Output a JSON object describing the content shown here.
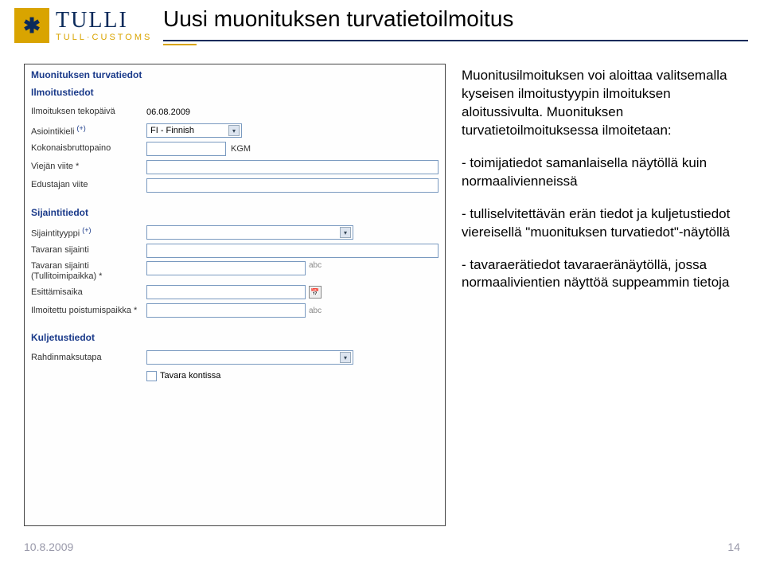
{
  "logo": {
    "main": "TULLI",
    "sub": "TULL·CUSTOMS",
    "mark": "✱"
  },
  "title": "Uusi muonituksen turvatietoilmoitus",
  "form": {
    "heading": "Muonituksen turvatiedot",
    "section_ilmoitus": {
      "title": "Ilmoitustiedot",
      "tekopaiva_label": "Ilmoituksen tekopäivä",
      "tekopaiva_value": "06.08.2009",
      "asiointikieli_label": "Asiointikieli",
      "asiointikieli_value": "FI - Finnish",
      "bruttopaino_label": "Kokonaisbruttopaino",
      "bruttopaino_unit": "KGM",
      "viejan_label": "Viejän viite *",
      "edustajan_label": "Edustajan viite"
    },
    "section_sijainti": {
      "title": "Sijaintitiedot",
      "tyyppi_label": "Sijaintityyppi",
      "tavaran_label": "Tavaran sijainti",
      "tullitoimi_label": "Tavaran sijainti (Tullitoimipaikka) *",
      "esittamis_label": "Esittämisaika",
      "poistumis_label": "Ilmoitettu poistumispaikka *",
      "abc_hint": "abc"
    },
    "section_kuljetus": {
      "title": "Kuljetustiedot",
      "rahdin_label": "Rahdinmaksutapa",
      "kontti": "Tavara kontissa"
    }
  },
  "side": {
    "p1": "Muonitusilmoituksen voi aloittaa valitsemalla kyseisen ilmoitustyypin ilmoituksen aloitussivulta. Muonituksen turvatietoilmoituksessa ilmoitetaan:",
    "b1": "- toimijatiedot samanlaisella näytöllä kuin normaalivienneissä",
    "b2": "- tulliselvitettävän erän tiedot ja kuljetustiedot viereisellä \"muonituksen turvatiedot\"-näytöllä",
    "b3": "- tavaraerätiedot tavaraeränäytöllä, jossa normaalivientien näyttöä suppeammin tietoja"
  },
  "footer": {
    "date": "10.8.2009",
    "page": "14"
  }
}
